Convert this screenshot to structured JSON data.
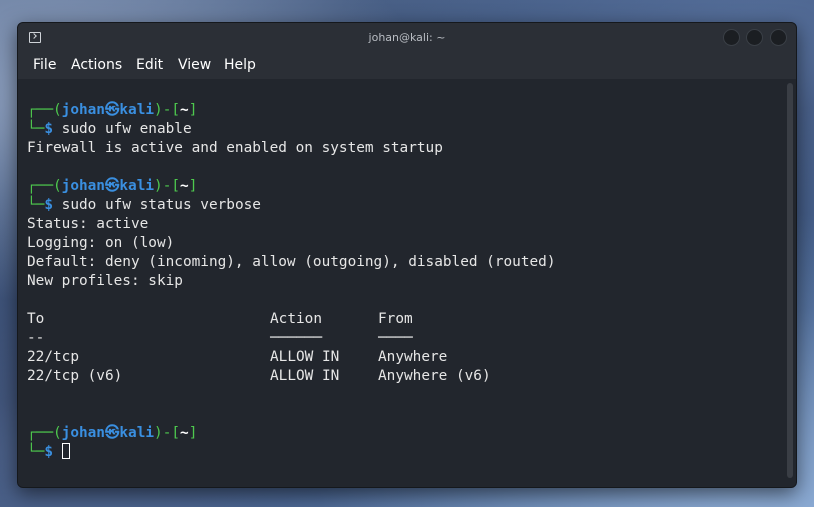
{
  "window": {
    "title": "johan@kali: ~",
    "icon": "terminal-icon"
  },
  "menu": [
    "File",
    "Actions",
    "Edit",
    "View",
    "Help"
  ],
  "prompt": {
    "open": "┌──(",
    "user": "johan",
    "at": "㉿",
    "host": "kali",
    "mid": ")-[",
    "dir": "~",
    "close": "]",
    "corner": "└─",
    "symbol": "$"
  },
  "terminal": {
    "cmd1": "sudo ufw enable",
    "out1": "Firewall is active and enabled on system startup",
    "cmd2": "sudo ufw status verbose",
    "status": "Status: active",
    "logging": "Logging: on (low)",
    "default": "Default: deny (incoming), allow (outgoing), disabled (routed)",
    "profiles": "New profiles: skip",
    "rules_header": [
      "To",
      "Action",
      "From"
    ],
    "rules_sep": [
      "--",
      "──────",
      "────"
    ],
    "rules": [
      [
        "22/tcp",
        "ALLOW IN",
        "Anywhere"
      ],
      [
        "22/tcp (v6)",
        "ALLOW IN",
        "Anywhere (v6)"
      ]
    ]
  },
  "colors": {
    "prompt_green": "#4ec94e",
    "prompt_blue": "#3a8fe0",
    "terminal_bg": "#22262d",
    "text": "#e6e6e6"
  }
}
